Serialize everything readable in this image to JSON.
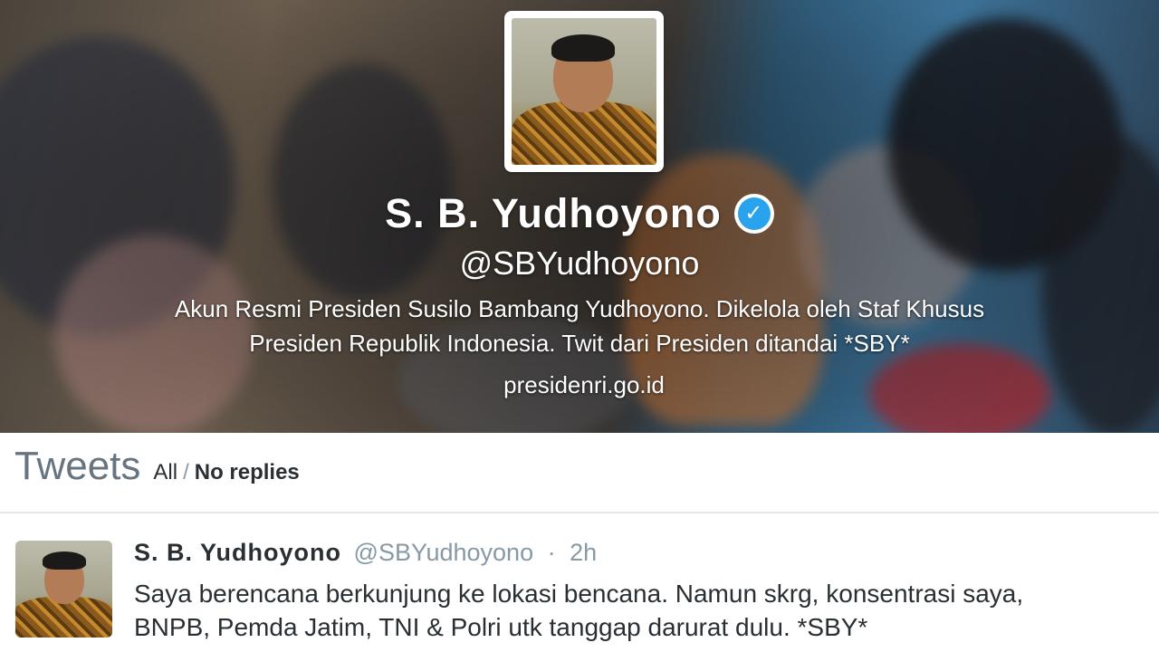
{
  "profile": {
    "display_name": "S. B. Yudhoyono",
    "verified_icon": "verified-badge-icon",
    "handle": "@SBYudhoyono",
    "bio_line1": "Akun Resmi Presiden Susilo Bambang Yudhoyono. Dikelola oleh Staf Khusus",
    "bio_line2": "Presiden Republik Indonesia. Twit dari Presiden ditandai *SBY*",
    "website": "presidenri.go.id"
  },
  "timeline": {
    "title": "Tweets",
    "filters": {
      "all": "All",
      "separator": "/",
      "no_replies": "No replies"
    }
  },
  "tweet": {
    "name": "S. B. Yudhoyono",
    "handle": "@SBYudhoyono",
    "dot": "·",
    "time": "2h",
    "text_line1": "Saya berencana berkunjung ke lokasi bencana. Namun skrg, konsentrasi saya,",
    "text_line2": "BNPB, Pemda Jatim, TNI & Polri utk tanggap darurat dulu. *SBY*"
  },
  "colors": {
    "verified": "#2aa3ef",
    "text_primary": "#292f33",
    "text_muted": "#8899a6",
    "heading": "#66757f"
  }
}
